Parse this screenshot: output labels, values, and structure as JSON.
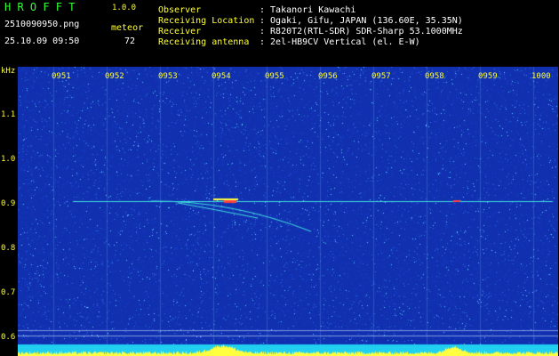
{
  "header": {
    "logo": "H R O F F T",
    "version": "1.0.0",
    "filename": "2510090950.png",
    "datetime": "25.10.09 09:50",
    "event_label": "meteor",
    "event_count": "72",
    "info": [
      {
        "label": "Observer",
        "value": ": Takanori Kawachi"
      },
      {
        "label": "Receiving Location",
        "value": ": Ogaki, Gifu, JAPAN (136.60E, 35.35N)"
      },
      {
        "label": "Receiver",
        "value": ": R820T2(RTL-SDR) SDR-Sharp 53.1000MHz"
      },
      {
        "label": "Receiving antenna",
        "value": ": 2el-HB9CV Vertical (el. E-W)"
      }
    ]
  },
  "axes": {
    "y_unit": "kHz",
    "y_ticks": [
      "1.1",
      "1.0",
      "0.9",
      "0.8",
      "0.7",
      "0.6"
    ],
    "x_ticks": [
      "0951",
      "0952",
      "0953",
      "0954",
      "0955",
      "0956",
      "0957",
      "0958",
      "0959",
      "1000"
    ]
  },
  "colors": {
    "background": "#1030b0",
    "signal": "#40e0e0",
    "hot": "#ffff40",
    "baseline": "#20d0f0"
  }
}
